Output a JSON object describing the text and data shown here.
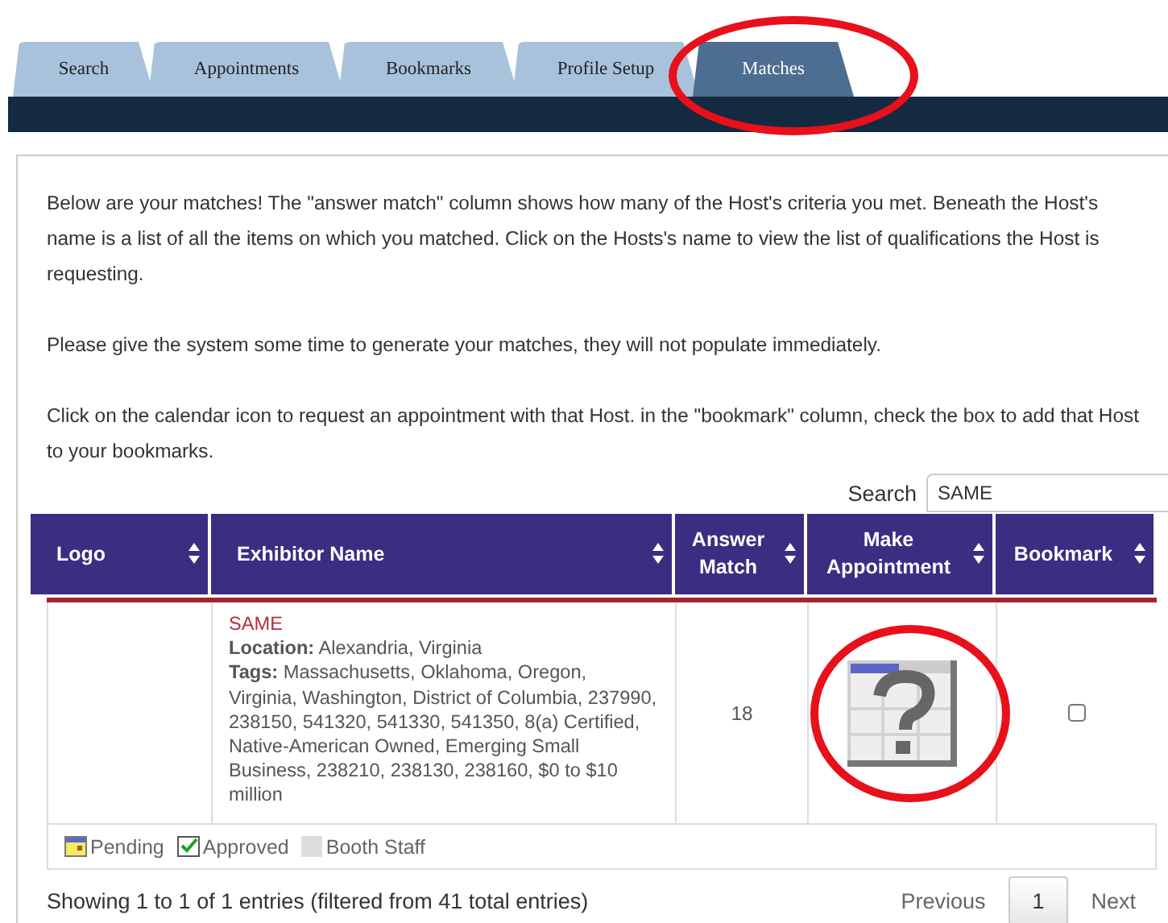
{
  "tabs": [
    {
      "label": "Search",
      "selected": false
    },
    {
      "label": "Appointments",
      "selected": false
    },
    {
      "label": "Bookmarks",
      "selected": false
    },
    {
      "label": "Profile Setup",
      "selected": false
    },
    {
      "label": "Matches",
      "selected": true
    }
  ],
  "intro": [
    "Below are your matches!  The \"answer match\" column shows how many of the Host's criteria you met. Beneath the Host's name is a list of all the items on which you matched.  Click on the Hosts's name to view the list of qualifications the Host is requesting.",
    "Please give the system some time to generate your matches, they will not populate immediately.",
    "Click on the calendar icon to request an appointment with that Host. in the \"bookmark\" column, check the box to add that Host to your bookmarks."
  ],
  "search": {
    "label": "Search",
    "value": "SAME"
  },
  "table": {
    "columns": [
      "Logo",
      "Exhibitor Name",
      "Answer Match",
      "Make Appointment",
      "Bookmark"
    ],
    "rows": [
      {
        "name": "SAME",
        "location": "**Location:** Alexandria, Virginia",
        "tags": "**Tags:** Massachusetts, Oklahoma, Oregon, Virginia, Washington, District of Columbia, 237990, 238150, 541320, 541330, 541350, 8(a) Certified, Native-American Owned, Emerging Small Business, 238210, 238130, 238160, $0 to $10 million",
        "answer_match": "18",
        "bookmarked": false
      }
    ]
  },
  "legend": [
    {
      "kind": "pending",
      "label": "Pending"
    },
    {
      "kind": "approved",
      "label": "Approved"
    },
    {
      "kind": "staff",
      "label": "Booth Staff"
    }
  ],
  "info": "Showing 1 to 1 of 1 entries (filtered from 41 total entries)",
  "pagination": {
    "previous": "Previous",
    "pages": [
      {
        "label": "1",
        "selected": true
      }
    ],
    "next": "Next"
  }
}
